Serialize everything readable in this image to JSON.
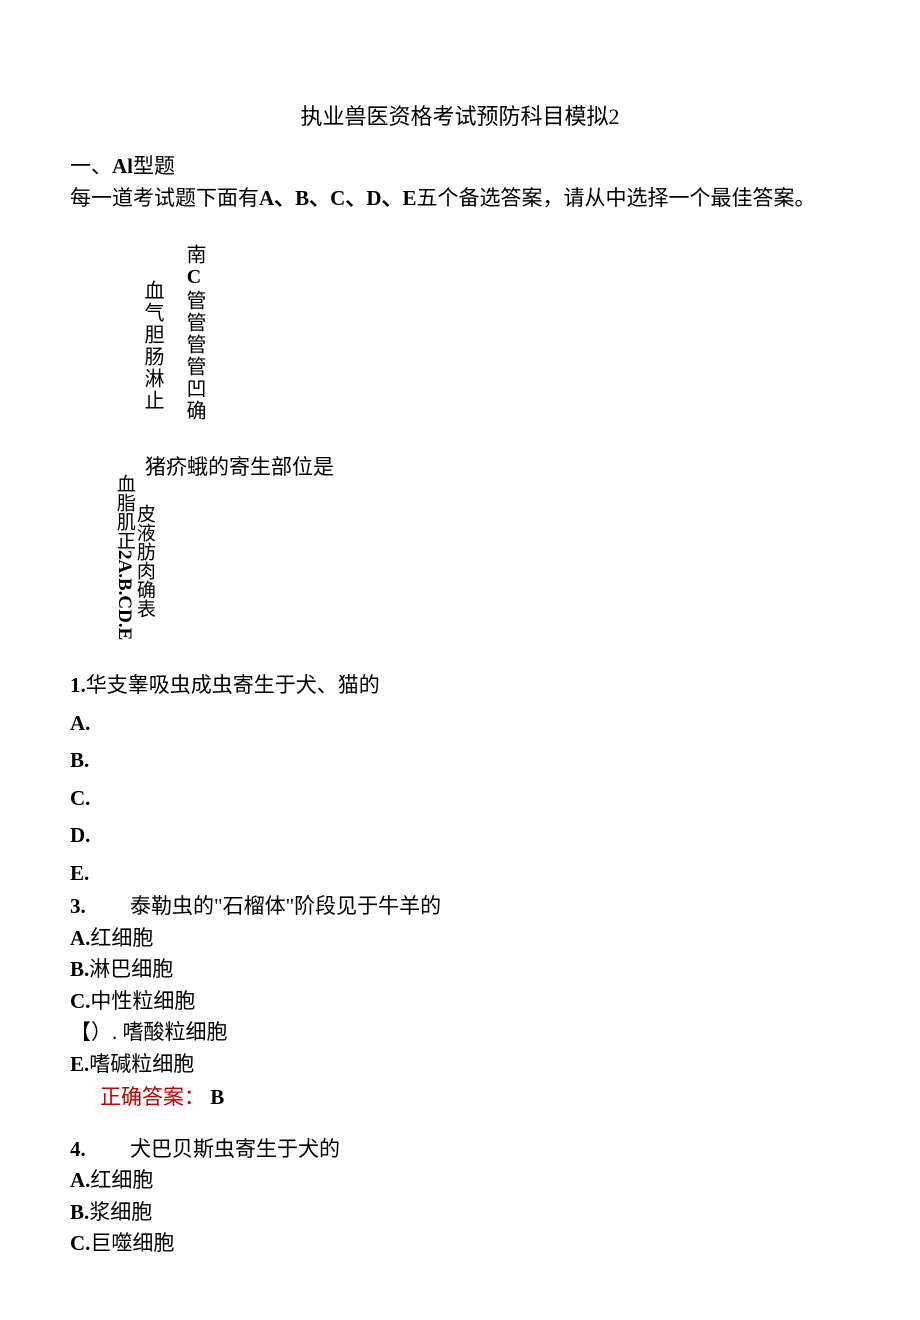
{
  "title": "执业兽医资格考试预防科目模拟2",
  "section_label_prefix": "一、",
  "section_label_bold": "Al",
  "section_label_suffix": "型题",
  "instructions_a": "每一道考试题下面有",
  "instructions_letters": "A、B、C、D、E",
  "instructions_b": "五个备选答案，请从中选择一个最佳答案。",
  "vert1": {
    "col_left": "血气胆肠淋止",
    "col_right_top": "南",
    "col_right_bold": "C",
    "col_right_mid": "管管管管凹确"
  },
  "vert2": {
    "question": "猪疥蛾的寄生部位是",
    "col_left_a": "血脂肌正",
    "col_left_b": "2A.B.CD.E",
    "col_right": "皮液肪肉确表"
  },
  "q1": {
    "num": "1.",
    "text": "华支睾吸虫成虫寄生于犬、猫的",
    "opts": [
      "A.",
      "B.",
      "C.",
      "D.",
      "E."
    ]
  },
  "q3": {
    "num": "3.",
    "text": "泰勒虫的\"石榴体\"阶段见于牛羊的",
    "a": "红细胞",
    "b": "淋巴细胞",
    "c": "中性粒细胞",
    "d_prefix": "【）.",
    "d": "嗜酸粒细胞",
    "e": "嗜碱粒细胞",
    "answer_label": "正确答案：",
    "answer": "B"
  },
  "q4": {
    "num": "4.",
    "text": "犬巴贝斯虫寄生于犬的",
    "a": "红细胞",
    "b": "浆细胞",
    "c": "巨噬细胞"
  }
}
